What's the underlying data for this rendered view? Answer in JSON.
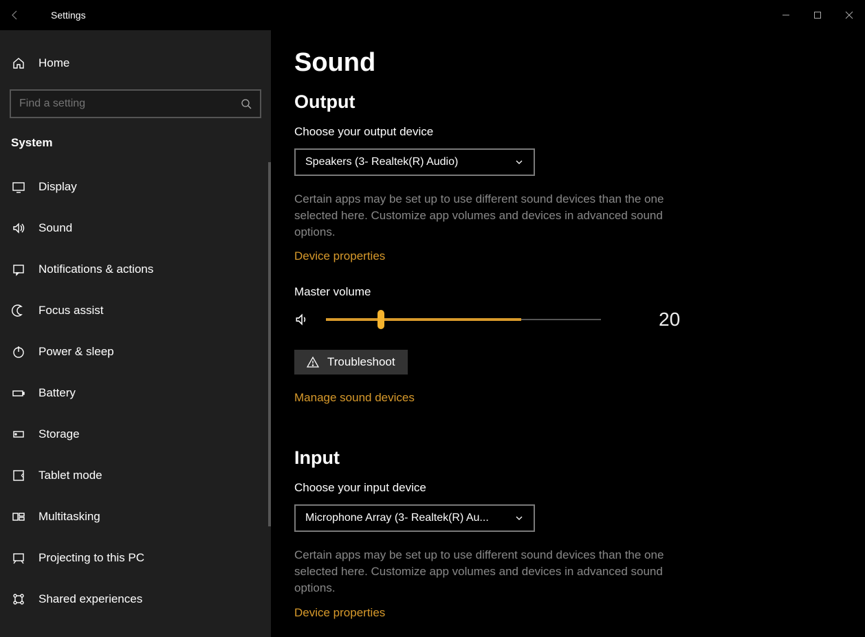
{
  "window": {
    "title": "Settings"
  },
  "sidebar": {
    "home_label": "Home",
    "search_placeholder": "Find a setting",
    "category_header": "System",
    "items": [
      {
        "label": "Display",
        "icon": "display-icon"
      },
      {
        "label": "Sound",
        "icon": "sound-icon"
      },
      {
        "label": "Notifications & actions",
        "icon": "notifications-icon"
      },
      {
        "label": "Focus assist",
        "icon": "focus-assist-icon"
      },
      {
        "label": "Power & sleep",
        "icon": "power-icon"
      },
      {
        "label": "Battery",
        "icon": "battery-icon"
      },
      {
        "label": "Storage",
        "icon": "storage-icon"
      },
      {
        "label": "Tablet mode",
        "icon": "tablet-icon"
      },
      {
        "label": "Multitasking",
        "icon": "multitasking-icon"
      },
      {
        "label": "Projecting to this PC",
        "icon": "projecting-icon"
      },
      {
        "label": "Shared experiences",
        "icon": "shared-icon"
      }
    ]
  },
  "main": {
    "title": "Sound",
    "output": {
      "heading": "Output",
      "choose_label": "Choose your output device",
      "selected": "Speakers (3- Realtek(R) Audio)",
      "helper": "Certain apps may be set up to use different sound devices than the one selected here. Customize app volumes and devices in advanced sound options.",
      "device_properties_link": "Device properties",
      "master_volume_label": "Master volume",
      "master_volume_value": "20",
      "troubleshoot_label": "Troubleshoot",
      "manage_link": "Manage sound devices"
    },
    "input": {
      "heading": "Input",
      "choose_label": "Choose your input device",
      "selected": "Microphone Array (3- Realtek(R) Au...",
      "helper": "Certain apps may be set up to use different sound devices than the one selected here. Customize app volumes and devices in advanced sound options.",
      "device_properties_link": "Device properties"
    }
  },
  "accent_color": "#d89a2b"
}
